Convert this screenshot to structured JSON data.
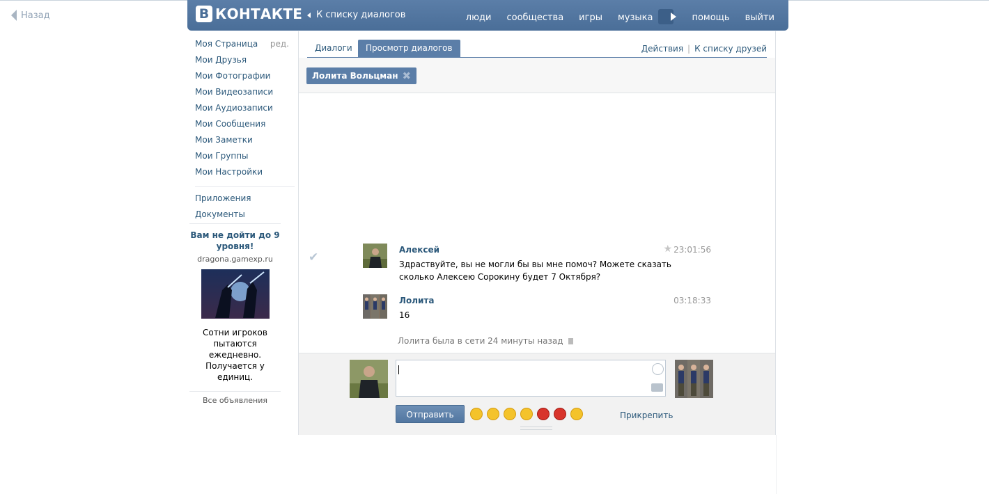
{
  "browser": {
    "back_label": "Назад"
  },
  "header": {
    "logo_letter": "В",
    "logo_text": "КОНТАКТЕ",
    "back_to_dialogs": "К списку диалогов",
    "nav": [
      "люди",
      "сообщества",
      "игры",
      "музыка",
      "помощь",
      "выйти"
    ]
  },
  "sidebar": {
    "items": [
      "Моя Страница",
      "Мои Друзья",
      "Мои Фотографии",
      "Мои Видеозаписи",
      "Мои Аудиозаписи",
      "Мои Сообщения",
      "Мои Заметки",
      "Мои Группы",
      "Мои Настройки"
    ],
    "edit_label": "ред.",
    "extra_items": [
      "Приложения",
      "Документы"
    ]
  },
  "ad": {
    "title": "Вам не дойти до 9 уровня!",
    "domain": "dragona.gamexp.ru",
    "description": "Сотни игроков пытаются ежедневно. Получается у единиц.",
    "all_ads": "Все объявления"
  },
  "tabs": {
    "items": [
      "Диалоги",
      "Просмотр диалогов"
    ],
    "active_index": 1,
    "actions": "Действия",
    "friends_list": "К списку друзей"
  },
  "filter": {
    "chip_label": "Лолита Вольцман"
  },
  "messages": [
    {
      "author": "Алексей",
      "text": "Здраствуйте, вы не могли бы вы мне помоч? Можете сказать сколько Алексею Сорокину будет 7 Октября?",
      "time": "23:01:56"
    },
    {
      "author": "Лолита",
      "text": "16",
      "time": "03:18:33"
    }
  ],
  "status": {
    "online_text": "Лолита была в сети 24 минуты назад"
  },
  "compose": {
    "send_label": "Отправить",
    "attach_label": "Прикрепить",
    "emoji_icons": [
      "laughing-face",
      "smiling-face",
      "neutral-face",
      "grinning-face",
      "18-plus",
      "no-entry",
      "sunglasses-face"
    ]
  },
  "colors": {
    "brand": "#5b7ea8",
    "link": "#2b587a",
    "header_dark": "#4a6e98"
  }
}
